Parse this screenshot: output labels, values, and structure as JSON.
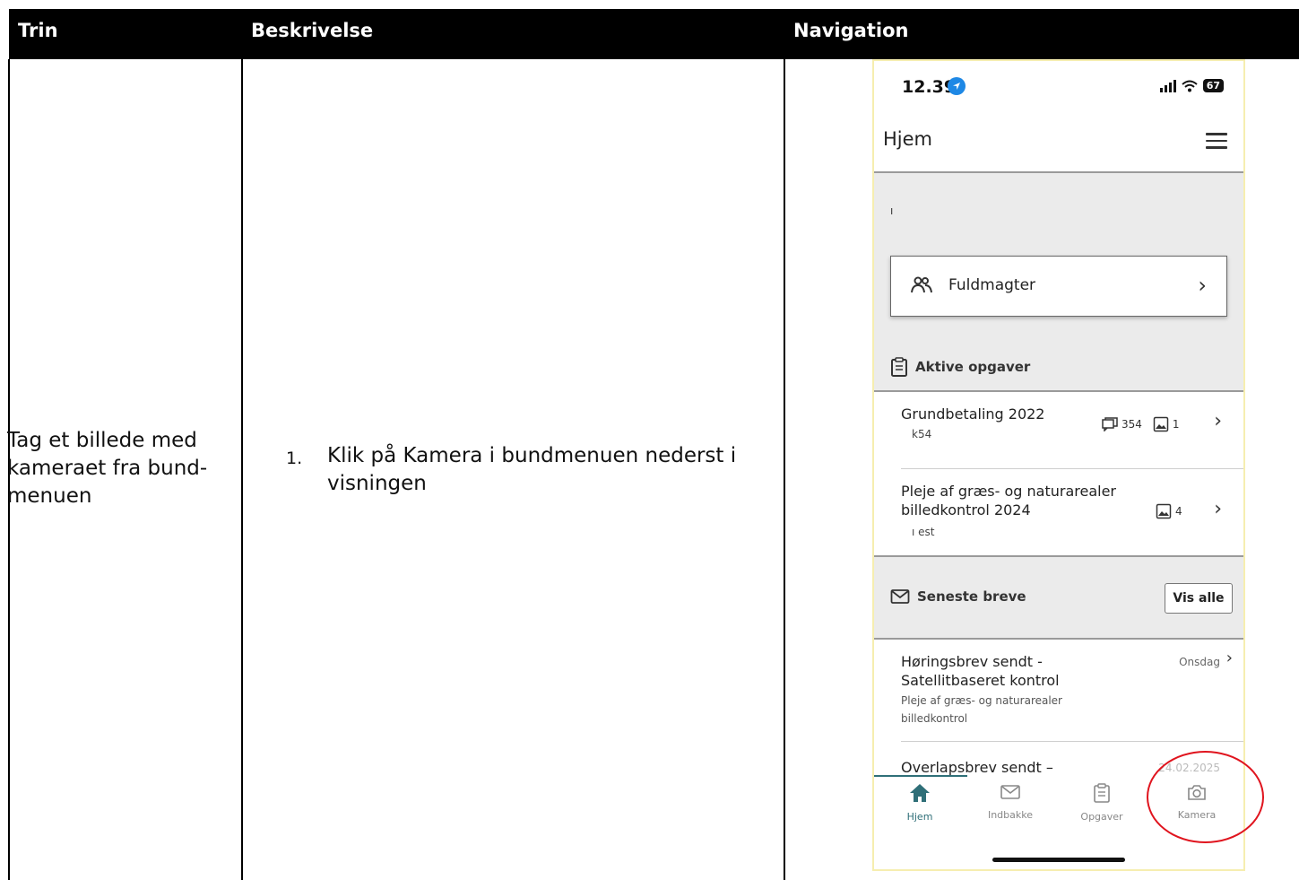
{
  "table": {
    "headers": [
      "Trin",
      "Beskrivelse",
      "Navigation"
    ],
    "step": "Tag et billede med kameraet fra bund-menuen",
    "step_number": "1.",
    "description": "Klik på Kamera i bundmenuen nederst i visningen"
  },
  "phone": {
    "time": "12.39",
    "battery": "67",
    "title": "Hjem",
    "stray_text": "ı",
    "fuldmagter": "Fuldmagter",
    "active_tasks_heading": "Aktive opgaver",
    "tasks": [
      {
        "title": "Grundbetaling 2022",
        "subtitle": "k54",
        "comments": "354",
        "images": "1"
      },
      {
        "title": "Pleje af græs- og naturarealer billedkontrol 2024",
        "subtitle": "ı est",
        "images": "4"
      }
    ],
    "letters_heading": "Seneste breve",
    "see_all": "Vis alle",
    "letters": [
      {
        "title": "Høringsbrev sendt - Satellitbaseret kontrol",
        "description": "Pleje af græs- og naturarealer billedkontrol",
        "date": "Onsdag"
      },
      {
        "title": "Overlapsbrev sendt –",
        "date": "24.02.2025"
      }
    ],
    "tabs": [
      "Hjem",
      "Indbakke",
      "Opgaver",
      "Kamera"
    ],
    "accent_color": "#2f6f78",
    "highlight_color": "#e0141e"
  }
}
